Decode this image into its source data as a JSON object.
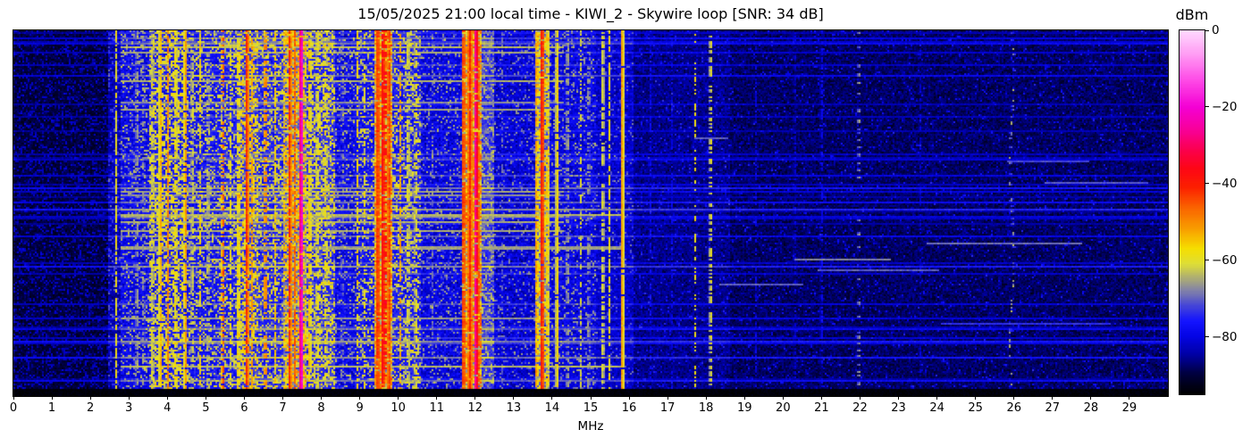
{
  "chart_data": {
    "type": "heatmap",
    "subtype": "hf-spectrogram-waterfall",
    "title": "15/05/2025 21:00 local time - KIWI_2 - Skywire loop [SNR: 34 dB]",
    "station": "KIWI_2",
    "antenna": "Skywire loop",
    "snr_label": "SNR: 34 dB",
    "datetime_label": "15/05/2025 21:00 local time",
    "xlabel": "MHz",
    "x_range": [
      0,
      30
    ],
    "x_ticks": [
      0,
      1,
      2,
      3,
      4,
      5,
      6,
      7,
      8,
      9,
      10,
      11,
      12,
      13,
      14,
      15,
      16,
      17,
      18,
      19,
      20,
      21,
      22,
      23,
      24,
      25,
      26,
      27,
      28,
      29
    ],
    "grid": false,
    "colorbar": {
      "label": "dBm",
      "tick_values": [
        0,
        -20,
        -40,
        -60,
        -80
      ],
      "tick_labels": [
        "0",
        "−20",
        "−40",
        "−60",
        "−80"
      ],
      "range": [
        0,
        -95
      ]
    },
    "colormap_stops": [
      [
        -95,
        "#000000"
      ],
      [
        -90,
        "#00003a"
      ],
      [
        -85,
        "#0000a0"
      ],
      [
        -80,
        "#0404e4"
      ],
      [
        -76,
        "#1414ff"
      ],
      [
        -72,
        "#4444d8"
      ],
      [
        -68,
        "#8282a8"
      ],
      [
        -65,
        "#a9a978"
      ],
      [
        -61,
        "#dede36"
      ],
      [
        -57,
        "#f6de00"
      ],
      [
        -52,
        "#f8a000"
      ],
      [
        -46,
        "#fa6000"
      ],
      [
        -41,
        "#fc2000"
      ],
      [
        -36,
        "#fd0616"
      ],
      [
        -31,
        "#fb0050"
      ],
      [
        -26,
        "#f80098"
      ],
      [
        -20,
        "#f400d4"
      ],
      [
        -13,
        "#fe4ae6"
      ],
      [
        -6,
        "#ff9ef4"
      ],
      [
        0,
        "#ffd9ff"
      ]
    ],
    "noise_floor_bands_mhz_dbm": [
      [
        0.0,
        2.45,
        -90,
        3,
        0.22,
        -83,
        3
      ],
      [
        2.45,
        2.8,
        -84,
        4,
        0.18,
        -73,
        4
      ],
      [
        2.8,
        3.55,
        -79,
        5,
        0.2,
        -66,
        5
      ],
      [
        3.55,
        4.4,
        -76,
        5,
        0.42,
        -60,
        5
      ],
      [
        4.4,
        5.35,
        -77,
        5,
        0.27,
        -63,
        5
      ],
      [
        5.35,
        5.8,
        -76,
        5,
        0.3,
        -62,
        5
      ],
      [
        5.8,
        6.35,
        -73,
        5,
        0.45,
        -58,
        6
      ],
      [
        6.35,
        7.0,
        -75,
        5,
        0.3,
        -62,
        5
      ],
      [
        7.0,
        7.62,
        -69,
        6,
        0.5,
        -55,
        6
      ],
      [
        7.62,
        8.35,
        -74,
        5,
        0.38,
        -60,
        5
      ],
      [
        8.35,
        8.95,
        -79,
        5,
        0.18,
        -66,
        5
      ],
      [
        8.95,
        9.4,
        -77,
        5,
        0.25,
        -63,
        5
      ],
      [
        9.4,
        9.85,
        -63,
        6,
        0.5,
        -49,
        6
      ],
      [
        9.85,
        10.6,
        -76,
        5,
        0.3,
        -62,
        5
      ],
      [
        10.6,
        11.65,
        -80,
        5,
        0.15,
        -68,
        5
      ],
      [
        11.65,
        12.15,
        -64,
        6,
        0.5,
        -49,
        6
      ],
      [
        12.15,
        12.5,
        -73,
        5,
        0.28,
        -65,
        4
      ],
      [
        12.5,
        13.55,
        -81,
        5,
        0.12,
        -69,
        4
      ],
      [
        13.55,
        13.95,
        -69,
        6,
        0.42,
        -57,
        6
      ],
      [
        13.95,
        15.15,
        -80,
        5,
        0.13,
        -67,
        4
      ],
      [
        15.15,
        16.1,
        -82,
        4,
        0.09,
        -71,
        4
      ],
      [
        16.1,
        18.6,
        -86,
        3.5,
        0.06,
        -77,
        4
      ],
      [
        18.6,
        30.0,
        -88,
        3.5,
        0.05,
        -79,
        4
      ]
    ],
    "signal_lines_mhz": [
      [
        0.77,
        0.024,
        -83,
        0.3,
        0
      ],
      [
        1.62,
        0.024,
        -83,
        0.25,
        0
      ],
      [
        2.66,
        0.024,
        -57,
        0.75,
        0
      ],
      [
        3.21,
        0.024,
        -62,
        0.5,
        0
      ],
      [
        3.38,
        0.024,
        -64,
        0.4,
        0
      ],
      [
        3.62,
        0.025,
        -57,
        0.6,
        0
      ],
      [
        3.82,
        0.025,
        -52,
        0.85,
        0
      ],
      [
        4.02,
        0.03,
        -49,
        0.8,
        0
      ],
      [
        4.22,
        0.025,
        -54,
        0.65,
        0
      ],
      [
        4.47,
        0.03,
        -50,
        0.8,
        0
      ],
      [
        4.65,
        0.024,
        -58,
        0.5,
        0
      ],
      [
        4.85,
        0.024,
        -56,
        0.6,
        0
      ],
      [
        5.06,
        0.024,
        -58,
        0.5,
        0
      ],
      [
        5.45,
        0.03,
        -45,
        0.5,
        0
      ],
      [
        5.65,
        0.024,
        -58,
        0.5,
        0
      ],
      [
        5.85,
        0.025,
        -52,
        0.7,
        0
      ],
      [
        6.07,
        0.035,
        -41,
        0.92,
        0
      ],
      [
        6.19,
        0.024,
        -50,
        0.6,
        0
      ],
      [
        6.55,
        0.03,
        -45,
        0.5,
        0
      ],
      [
        6.8,
        0.024,
        -55,
        0.6,
        0
      ],
      [
        7.18,
        0.035,
        -41,
        0.9,
        0
      ],
      [
        7.32,
        0.025,
        -45,
        0.8,
        0
      ],
      [
        7.49,
        0.03,
        -19,
        0.97,
        0
      ],
      [
        7.7,
        0.024,
        -52,
        0.6,
        0
      ],
      [
        7.9,
        0.024,
        -55,
        0.6,
        0
      ],
      [
        8.12,
        0.024,
        -56,
        0.5,
        0
      ],
      [
        8.55,
        0.024,
        -64,
        0.4,
        0
      ],
      [
        8.95,
        0.024,
        -55,
        0.6,
        0
      ],
      [
        9.12,
        0.024,
        -58,
        0.5,
        0
      ],
      [
        9.47,
        0.05,
        -42,
        0.9,
        0
      ],
      [
        9.6,
        0.04,
        -37,
        0.9,
        0
      ],
      [
        9.66,
        0.024,
        -29,
        0.45,
        0
      ],
      [
        9.76,
        0.04,
        -42,
        0.85,
        0
      ],
      [
        10.06,
        0.025,
        -52,
        0.6,
        0
      ],
      [
        10.26,
        0.024,
        -55,
        0.55,
        0
      ],
      [
        10.46,
        0.024,
        -57,
        0.5,
        0
      ],
      [
        10.9,
        0.024,
        -68,
        0.4,
        0
      ],
      [
        11.7,
        0.04,
        -42,
        0.85,
        0
      ],
      [
        11.86,
        0.04,
        -40,
        0.9,
        0
      ],
      [
        12.01,
        0.03,
        -26,
        0.9,
        0
      ],
      [
        12.1,
        0.025,
        -46,
        0.7,
        0
      ],
      [
        12.7,
        0.024,
        -70,
        0.35,
        0
      ],
      [
        13.6,
        0.025,
        -48,
        0.7,
        0
      ],
      [
        13.74,
        0.035,
        -38,
        0.95,
        0
      ],
      [
        13.88,
        0.024,
        -52,
        0.6,
        0
      ],
      [
        14.13,
        0.024,
        -55,
        0.9,
        0
      ],
      [
        14.4,
        0.024,
        -60,
        0.5,
        0
      ],
      [
        14.75,
        0.02,
        -60,
        0.45,
        0
      ],
      [
        14.95,
        0.02,
        -61,
        0.4,
        0
      ],
      [
        15.32,
        0.02,
        -56,
        0.7,
        0
      ],
      [
        15.48,
        0.02,
        -57,
        0.65,
        0
      ],
      [
        15.82,
        0.028,
        -51,
        0.97,
        0
      ],
      [
        16.55,
        0.024,
        -78,
        0.5,
        0
      ],
      [
        17.12,
        0.024,
        -79,
        0.5,
        0
      ],
      [
        17.72,
        0.024,
        -58,
        0.4,
        0
      ],
      [
        18.12,
        0.024,
        -57,
        0.45,
        0
      ],
      [
        19.3,
        0.024,
        -80,
        0.5,
        0
      ],
      [
        20.3,
        0.024,
        -77,
        0.5,
        0
      ],
      [
        21.0,
        0.024,
        -76,
        0.45,
        0
      ],
      [
        21.97,
        0.024,
        -62,
        0.15,
        0
      ],
      [
        23.58,
        0.024,
        -80,
        0.5,
        0
      ],
      [
        25.95,
        0.024,
        -66,
        0.3,
        1
      ],
      [
        26.8,
        0.024,
        -82,
        0.4,
        0
      ],
      [
        28.56,
        0.024,
        -79,
        0.6,
        0
      ]
    ],
    "time_streaks": {
      "rows": 205,
      "global_line_prob": 0.17,
      "global_line_boost_db": [
        3,
        8
      ],
      "strong_line_prob": 0.03,
      "strong_line_boost_db": [
        9,
        14
      ],
      "active_gray_row_prob": 0.085,
      "active_gray_row_level_dbm": [
        -67,
        -63
      ],
      "active_gray_row_range_mhz": [
        2.8,
        14.3
      ],
      "right_segment_prob": 0.06,
      "right_segment_level_dbm": [
        -74,
        -66
      ],
      "bottom_gap_rows": 4
    },
    "seed": 20250515
  }
}
